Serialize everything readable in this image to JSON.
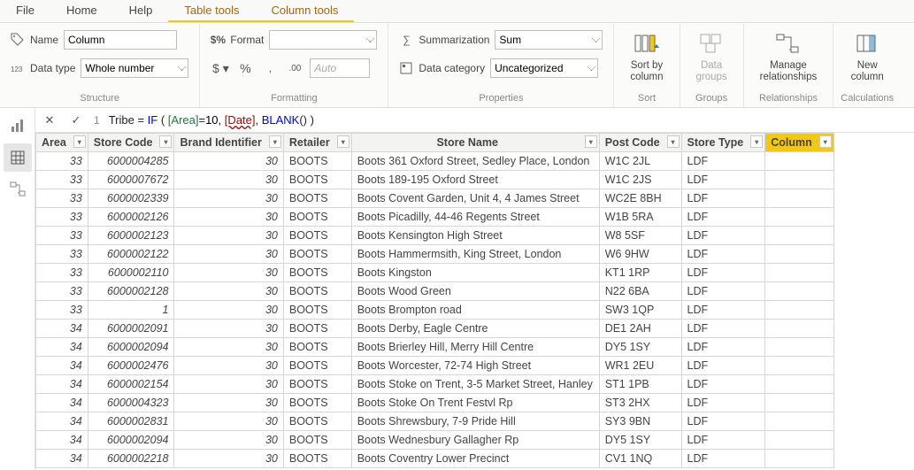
{
  "menu": {
    "file": "File",
    "home": "Home",
    "help": "Help",
    "table_tools": "Table tools",
    "column_tools": "Column tools"
  },
  "ribbon": {
    "structure": {
      "caption": "Structure",
      "name_label": "Name",
      "name_value": "Column",
      "datatype_label": "Data type",
      "datatype_value": "Whole number"
    },
    "formatting": {
      "caption": "Formatting",
      "format_label": "Format",
      "format_value": "",
      "auto_placeholder": "Auto"
    },
    "properties": {
      "caption": "Properties",
      "summarization_label": "Summarization",
      "summarization_value": "Sum",
      "datacategory_label": "Data category",
      "datacategory_value": "Uncategorized"
    },
    "sort": {
      "caption": "Sort",
      "btn": "Sort by\ncolumn"
    },
    "groups": {
      "caption": "Groups",
      "btn": "Data\ngroups"
    },
    "rel": {
      "caption": "Relationships",
      "btn": "Manage\nrelationships"
    },
    "calc": {
      "caption": "Calculations",
      "btn": "New\ncolumn"
    }
  },
  "formula": {
    "line": "1",
    "col_name": "Tribe",
    "eq": " = ",
    "kw_if": "IF",
    "area_ref": "[Area]",
    "num": "10",
    "date_ref": "[Date]",
    "blank_fn": "BLANK"
  },
  "table": {
    "headers": [
      "Area",
      "Store Code",
      "Brand Identifier",
      "Retailer",
      "Store Name",
      "Post Code",
      "Store Type",
      "Column"
    ],
    "selected_col": 7,
    "widths": [
      50,
      88,
      104,
      75,
      280,
      84,
      80,
      64
    ],
    "rows": [
      [
        "33",
        "6000004285",
        "30",
        "BOOTS",
        "Boots 361 Oxford Street, Sedley Place, London",
        "W1C 2JL",
        "LDF",
        ""
      ],
      [
        "33",
        "6000007672",
        "30",
        "BOOTS",
        "Boots  189-195 Oxford Street",
        "W1C 2JS",
        "LDF",
        ""
      ],
      [
        "33",
        "6000002339",
        "30",
        "BOOTS",
        "Boots Covent Garden, Unit 4, 4 James Street",
        "WC2E 8BH",
        "LDF",
        ""
      ],
      [
        "33",
        "6000002126",
        "30",
        "BOOTS",
        " Boots Picadilly, 44-46 Regents Street",
        "W1B 5RA",
        "LDF",
        ""
      ],
      [
        "33",
        "6000002123",
        "30",
        "BOOTS",
        "Boots Kensington High Street",
        "W8 5SF",
        "LDF",
        ""
      ],
      [
        "33",
        "6000002122",
        "30",
        "BOOTS",
        "Boots Hammermsith, King Street, London",
        "W6 9HW",
        "LDF",
        ""
      ],
      [
        "33",
        "6000002110",
        "30",
        "BOOTS",
        "Boots Kingston",
        "KT1 1RP",
        "LDF",
        ""
      ],
      [
        "33",
        "6000002128",
        "30",
        "BOOTS",
        "Boots Wood Green",
        "N22 6BA",
        "LDF",
        ""
      ],
      [
        "33",
        "1",
        "30",
        "BOOTS",
        "Boots Brompton road",
        "SW3 1QP",
        "LDF",
        ""
      ],
      [
        "34",
        "6000002091",
        "30",
        "BOOTS",
        "Boots Derby, Eagle Centre",
        "DE1 2AH",
        "LDF",
        ""
      ],
      [
        "34",
        "6000002094",
        "30",
        "BOOTS",
        "Boots Brierley Hill, Merry Hill Centre",
        "DY5 1SY",
        "LDF",
        ""
      ],
      [
        "34",
        "6000002476",
        "30",
        "BOOTS",
        "Boots Worcester, 72-74 High Street",
        "WR1 2EU",
        "LDF",
        ""
      ],
      [
        "34",
        "6000002154",
        "30",
        "BOOTS",
        "Boots Stoke on Trent, 3-5 Market Street, Hanley",
        "ST1 1PB",
        "LDF",
        ""
      ],
      [
        "34",
        "6000004323",
        "30",
        "BOOTS",
        "Boots Stoke On Trent Festvl Rp",
        "ST3 2HX",
        "LDF",
        ""
      ],
      [
        "34",
        "6000002831",
        "30",
        "BOOTS",
        " Boots Shrewsbury, 7-9 Pride Hill",
        "SY3 9BN",
        "LDF",
        ""
      ],
      [
        "34",
        "6000002094",
        "30",
        "BOOTS",
        "Boots Wednesbury Gallagher Rp",
        "DY5 1SY",
        "LDF",
        ""
      ],
      [
        "34",
        "6000002218",
        "30",
        "BOOTS",
        "Boots Coventry Lower Precinct",
        "CV1 1NQ",
        "LDF",
        ""
      ]
    ],
    "numeric_cols": [
      0,
      1,
      2
    ]
  }
}
